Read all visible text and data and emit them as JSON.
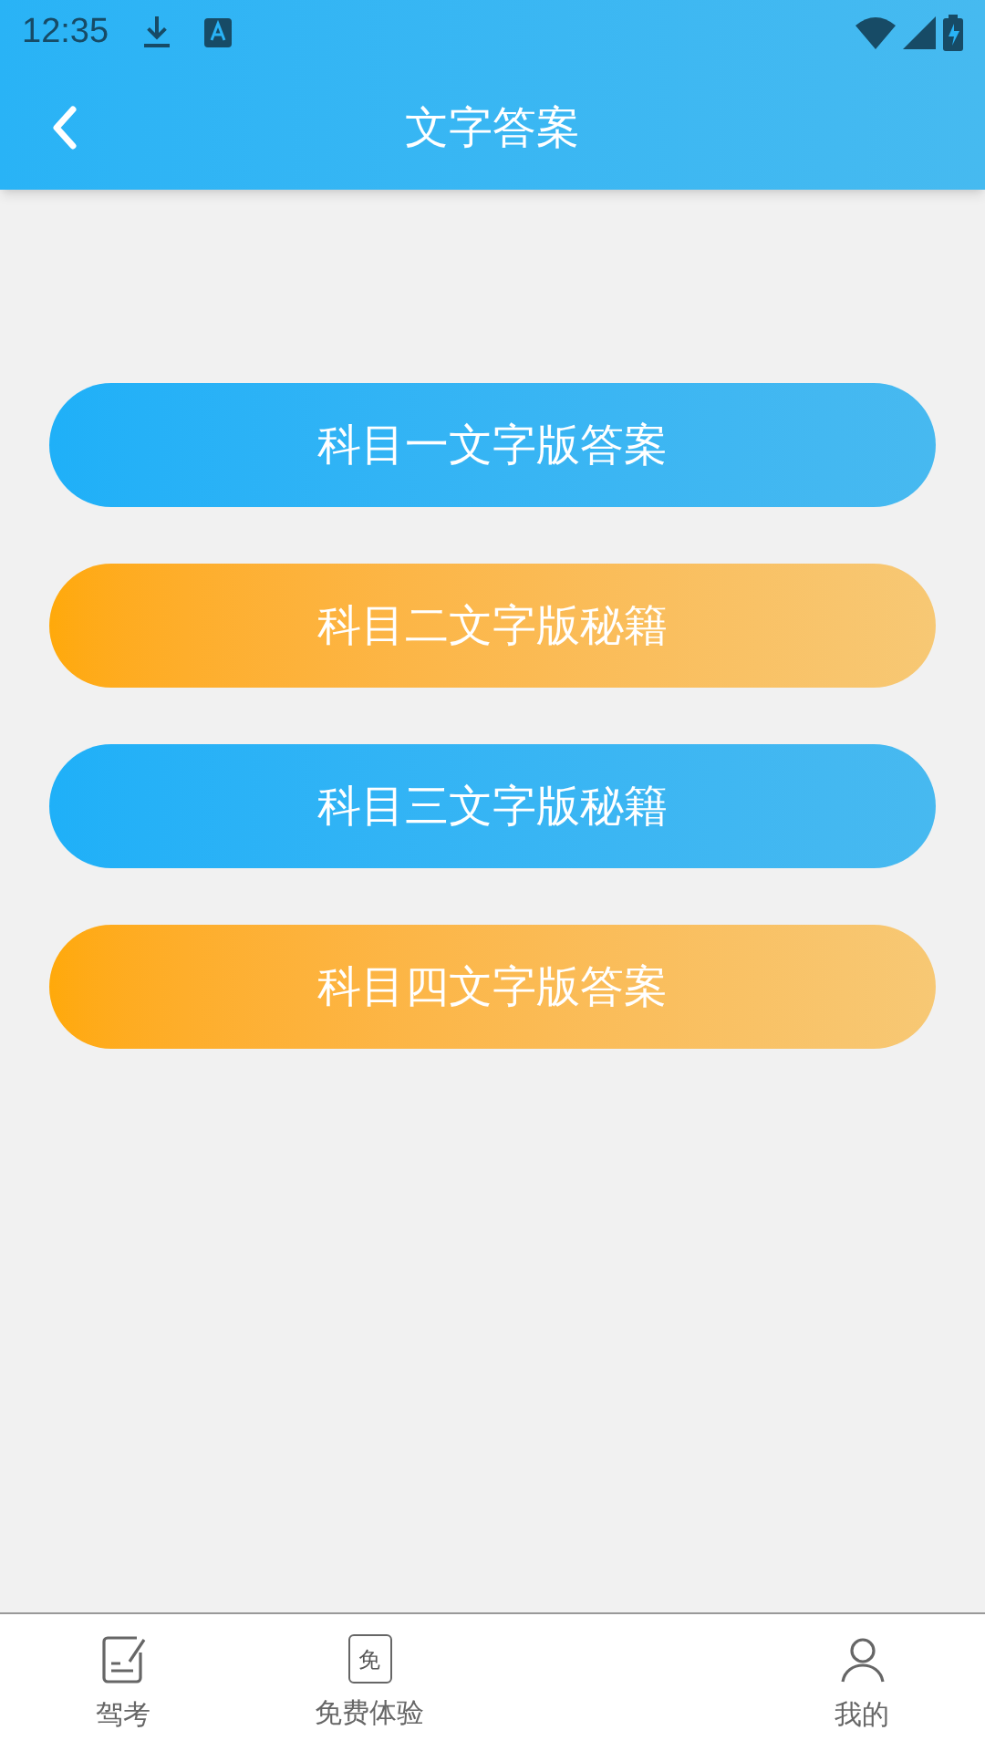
{
  "status_bar": {
    "time": "12:35"
  },
  "header": {
    "title": "文字答案"
  },
  "buttons": [
    {
      "label": "科目一文字版答案",
      "kind": "blue"
    },
    {
      "label": "科目二文字版秘籍",
      "kind": "orange"
    },
    {
      "label": "科目三文字版秘籍",
      "kind": "blue"
    },
    {
      "label": "科目四文字版答案",
      "kind": "orange"
    }
  ],
  "bottom_nav": [
    {
      "label": "驾考",
      "kind": "exam"
    },
    {
      "label": "免费体验",
      "kind": "free",
      "glyph": "免"
    },
    {
      "kind": "hidden"
    },
    {
      "label": "我的",
      "kind": "profile"
    }
  ]
}
